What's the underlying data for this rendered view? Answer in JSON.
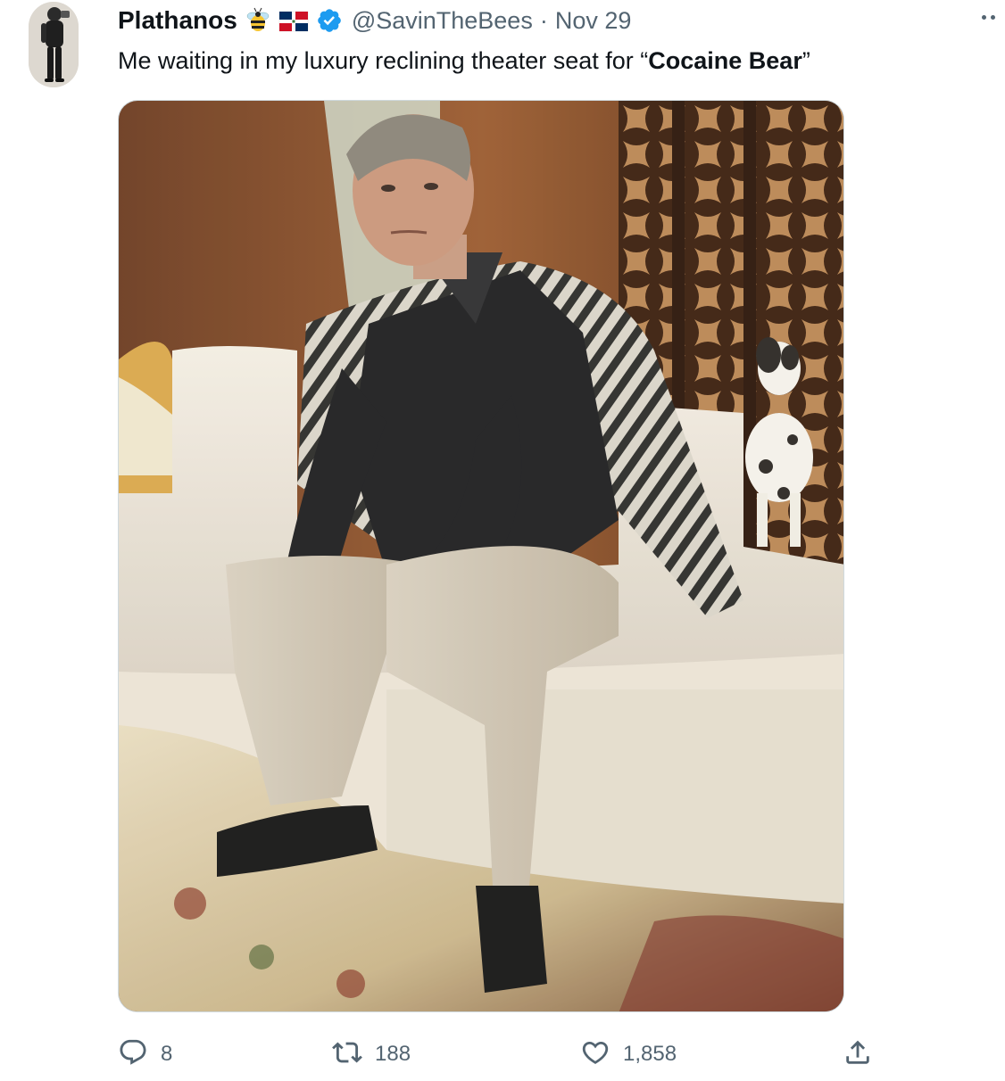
{
  "tweet": {
    "author": {
      "display_name": "Plathanos",
      "name_emojis": [
        "bee-emoji",
        "dominican-republic-flag-emoji"
      ],
      "verified": true,
      "handle": "@SavinTheBees",
      "separator": "·",
      "date": "Nov 29"
    },
    "text": {
      "before": "Me waiting in my luxury reclining theater seat for “",
      "bold": "Cocaine Bear",
      "after": "”"
    },
    "media": {
      "type": "photo",
      "description_icon": "photo-image"
    },
    "actions": {
      "replies": "8",
      "retweets": "188",
      "likes": "1,858"
    },
    "icons": {
      "reply": "reply-icon",
      "retweet": "retweet-icon",
      "like": "heart-icon",
      "share": "share-icon",
      "more": "more-icon",
      "verified": "verified-badge-icon"
    },
    "colors": {
      "text_primary": "#0f1419",
      "text_secondary": "#536471",
      "verified_blue": "#1d9bf0",
      "border": "#cfd9de"
    }
  }
}
